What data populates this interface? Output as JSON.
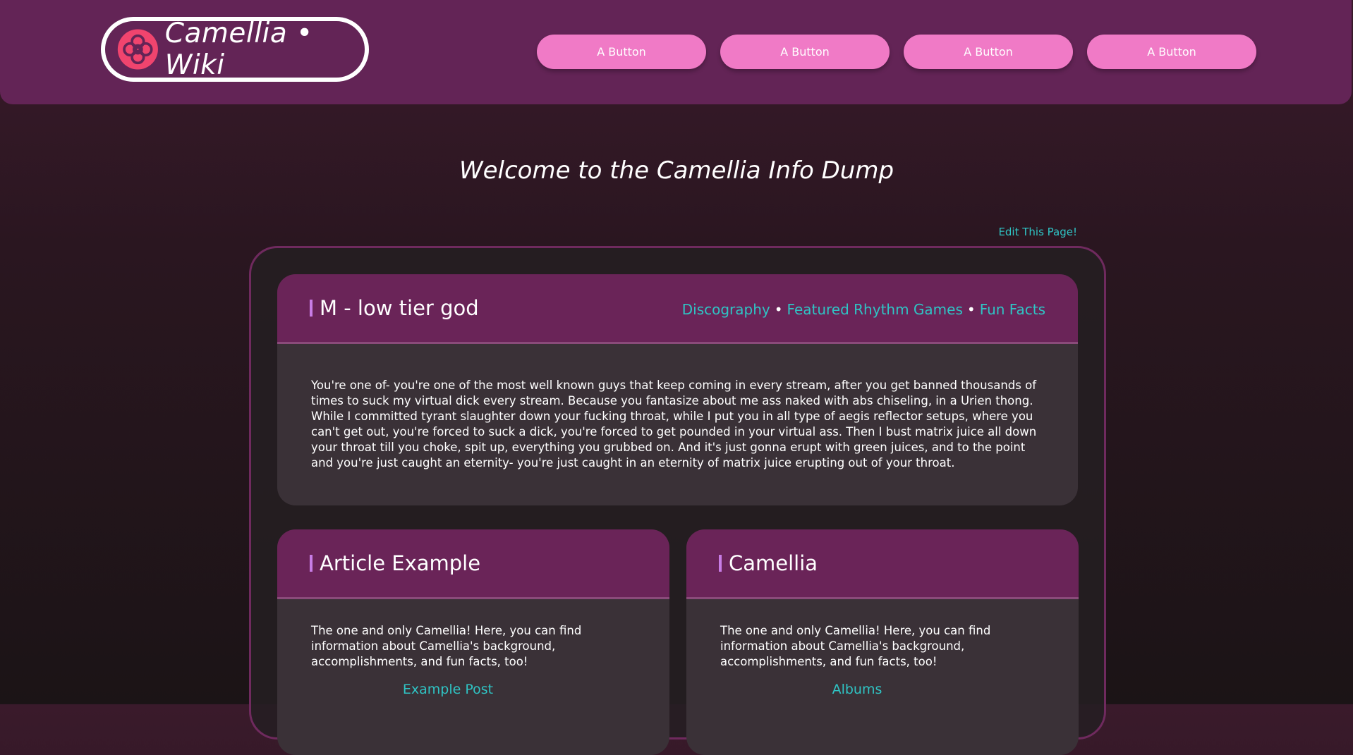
{
  "site": {
    "logo_text": "Camellia • Wiki",
    "accent": "#f07ac6",
    "header_bg": "#632456",
    "link_color": "#2fc4c4"
  },
  "nav": {
    "buttons": [
      "A Button",
      "A Button",
      "A Button",
      "A Button"
    ]
  },
  "page": {
    "title": "Welcome to the Camellia Info Dump",
    "edit_link": "Edit This Page!"
  },
  "main_card": {
    "title": "M - low tier god",
    "links": [
      "Discography",
      "Featured Rhythm Games",
      "Fun Facts"
    ],
    "separator": "•",
    "body": "You're one of- you're one of the most well known guys that keep coming in every stream, after you get banned thousands of times to suck my virtual dick every stream. Because you fantasize about me ass naked with abs chiseling, in a Urien thong. While I committed tyrant slaughter down your fucking throat, while I put you in all type of aegis reflector setups, where you can't get out, you're forced to suck a dick, you're forced to get pounded in your virtual ass. Then I bust matrix juice all down your throat till you choke, spit up, everything you grubbed on. And it's just gonna erupt with green juices, and to the point and you're just caught an eternity- you're just caught in an eternity of matrix juice erupting out of your throat."
  },
  "cards": [
    {
      "title": "Article Example",
      "body": "The one and only Camellia! Here, you can find information about Camellia's background, accomplishments, and fun facts, too!",
      "link": "Example Post"
    },
    {
      "title": "Camellia",
      "body": "The one and only Camellia! Here, you can find information about Camellia's background, accomplishments, and fun facts, too!",
      "link": "Albums"
    }
  ]
}
